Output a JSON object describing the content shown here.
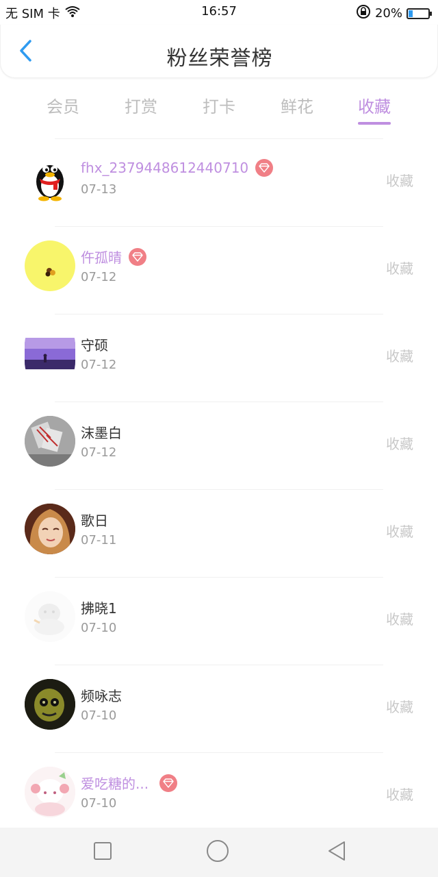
{
  "status_bar": {
    "carrier": "无 SIM 卡",
    "time": "16:57",
    "battery": "20%",
    "battery_level": 0.2
  },
  "header": {
    "title": "粉丝荣誉榜",
    "back_icon": "chevron-left-icon"
  },
  "tabs": [
    {
      "label": "会员"
    },
    {
      "label": "打赏"
    },
    {
      "label": "打卡"
    },
    {
      "label": "鲜花"
    },
    {
      "label": "收藏",
      "active": true
    }
  ],
  "colors": {
    "accent": "#bf8fe0",
    "badge": "#f07f86",
    "back": "#2f9bf0",
    "action_text": "#c8c8c8"
  },
  "fans": [
    {
      "name": "fhx_2379448612440710",
      "date": "07-13",
      "action": "收藏",
      "vip": true
    },
    {
      "name": "仵孤晴",
      "date": "07-12",
      "action": "收藏",
      "vip": true
    },
    {
      "name": "守硕",
      "date": "07-12",
      "action": "收藏",
      "vip": false
    },
    {
      "name": "沫墨白",
      "date": "07-12",
      "action": "收藏",
      "vip": false
    },
    {
      "name": "歌日",
      "date": "07-11",
      "action": "收藏",
      "vip": false
    },
    {
      "name": "拂晓1",
      "date": "07-10",
      "action": "收藏",
      "vip": false
    },
    {
      "name": "频咏志",
      "date": "07-10",
      "action": "收藏",
      "vip": false
    },
    {
      "name": "爱吃糖的...",
      "date": "07-10",
      "action": "收藏",
      "vip": true
    }
  ],
  "bottom_nav": {
    "items": [
      "recent-apps-icon",
      "home-icon",
      "back-triangle-icon"
    ]
  }
}
